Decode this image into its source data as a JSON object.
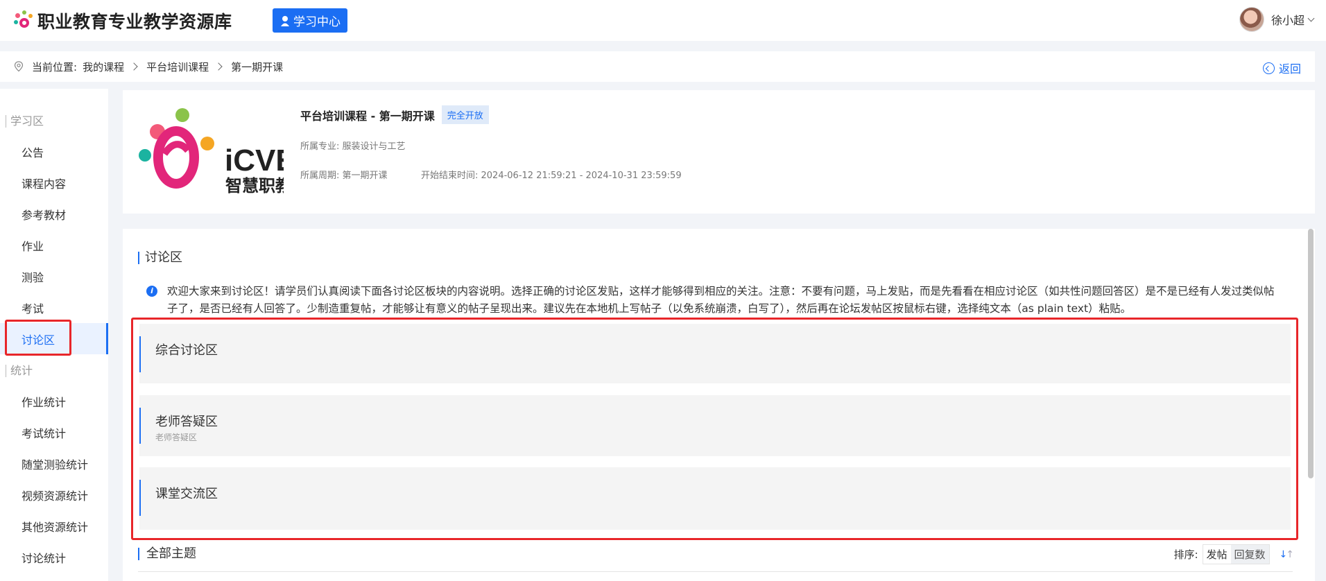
{
  "header": {
    "site_title": "职业教育专业教学资源库",
    "study_center": "学习中心",
    "username": "徐小超"
  },
  "breadcrumb": {
    "prefix": "当前位置:",
    "items": [
      "我的课程",
      "平台培训课程",
      "第一期开课"
    ],
    "back": "返回"
  },
  "sidebar": {
    "sections": [
      {
        "title": "学习区",
        "items": [
          "公告",
          "课程内容",
          "参考教材",
          "作业",
          "测验",
          "考试",
          "讨论区"
        ]
      },
      {
        "title": "统计",
        "items": [
          "作业统计",
          "考试统计",
          "随堂测验统计",
          "视频资源统计",
          "其他资源统计",
          "讨论统计"
        ]
      }
    ],
    "active": "讨论区"
  },
  "course": {
    "logo_text": "iCVE",
    "logo_subtext": "智慧职教",
    "title": "平台培训课程 - 第一期开课",
    "tag": "完全开放",
    "major": "所属专业: 服装设计与工艺",
    "period": "所属周期: 第一期开课",
    "time": "开始结束时间: 2024-06-12 21:59:21 - 2024-10-31 23:59:59"
  },
  "discussion": {
    "heading": "讨论区",
    "notice": "欢迎大家来到讨论区！请学员们认真阅读下面各讨论区板块的内容说明。选择正确的讨论区发贴，这样才能够得到相应的关注。注意：不要有问题，马上发贴，而是先看看在相应讨论区（如共性问题回答区）是不是已经有人发过类似帖子了，是否已经有人回答了。少制造重复帖，才能够让有意义的帖子呈现出来。建议先在本地机上写帖子（以免系统崩溃，白写了），然后再在论坛发帖区按鼠标右键，选择纯文本（as plain text）粘贴。",
    "boards": [
      {
        "name": "综合讨论区",
        "desc": ""
      },
      {
        "name": "老师答疑区",
        "desc": "老师答疑区"
      },
      {
        "name": "课堂交流区",
        "desc": ""
      }
    ],
    "all_topics": "全部主题",
    "sort_label": "排序:",
    "sort_options": [
      "发帖",
      "回复数"
    ]
  },
  "colors": {
    "accent": "#1b6ef3",
    "highlight": "#e8262a"
  }
}
